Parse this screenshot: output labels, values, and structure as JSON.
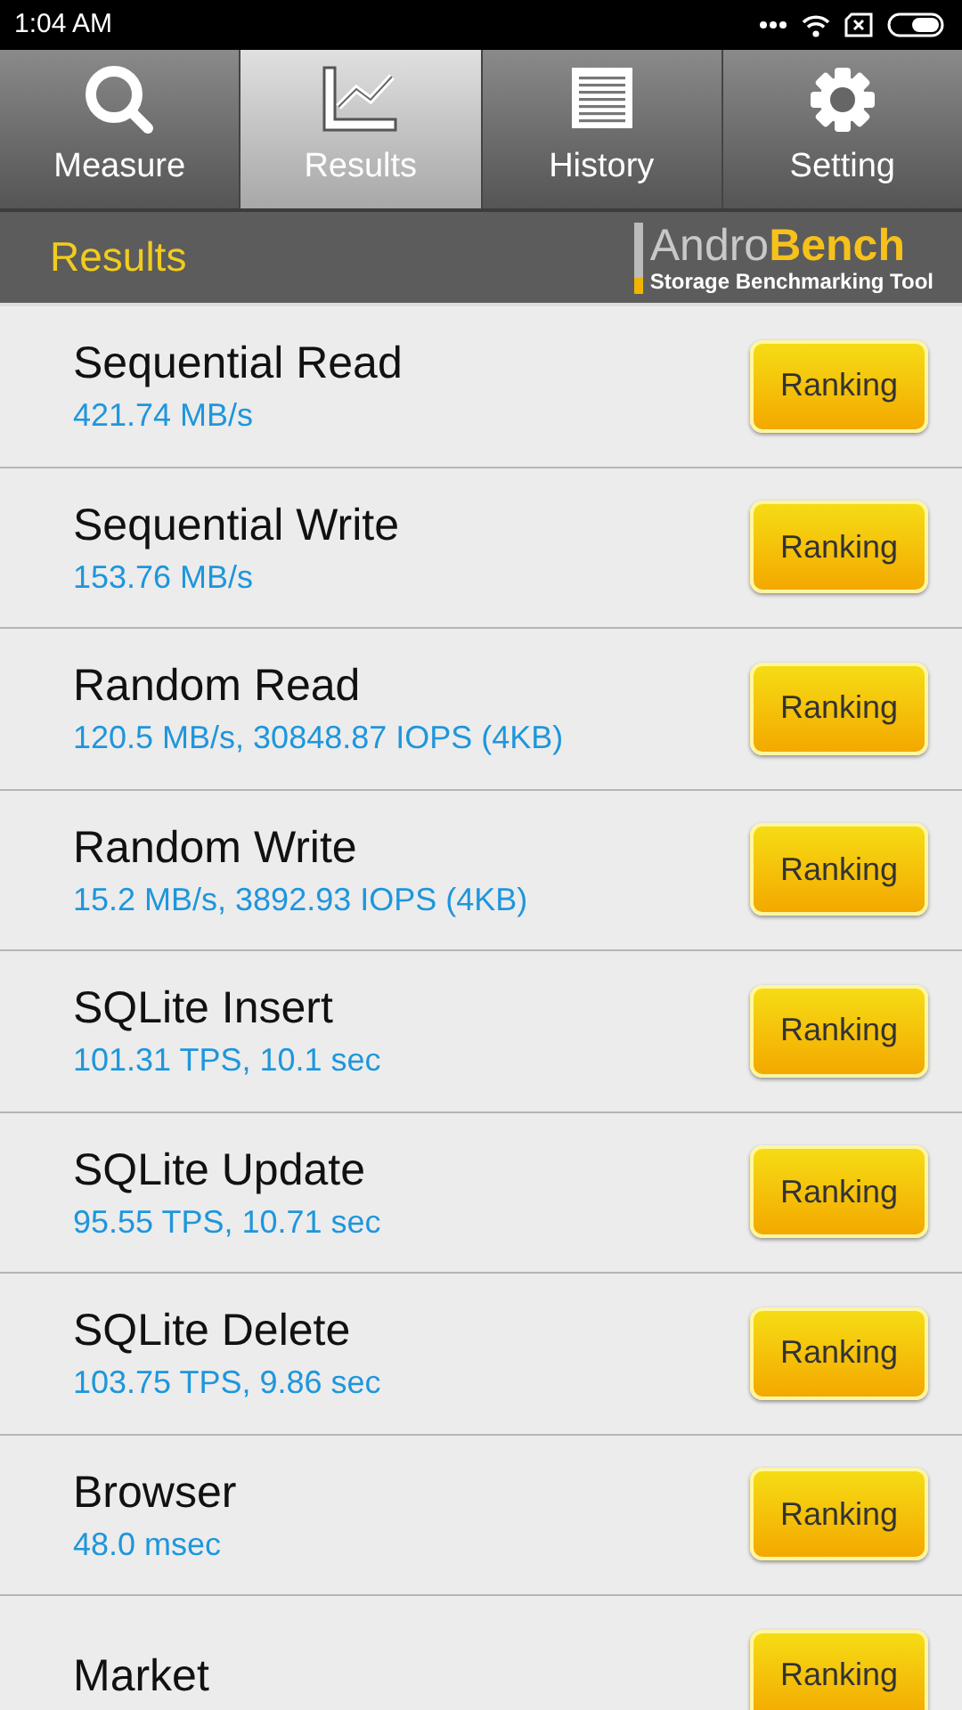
{
  "status_bar": {
    "time": "1:04 AM"
  },
  "tabs": [
    {
      "label": "Measure",
      "selected": false
    },
    {
      "label": "Results",
      "selected": true
    },
    {
      "label": "History",
      "selected": false
    },
    {
      "label": "Setting",
      "selected": false
    }
  ],
  "header": {
    "title": "Results",
    "brand_first": "Andro",
    "brand_second": "Bench",
    "tagline": "Storage Benchmarking Tool"
  },
  "results": [
    {
      "name": "Sequential Read",
      "value": "421.74 MB/s",
      "button": "Ranking"
    },
    {
      "name": "Sequential Write",
      "value": "153.76 MB/s",
      "button": "Ranking"
    },
    {
      "name": "Random Read",
      "value": "120.5 MB/s, 30848.87 IOPS (4KB)",
      "button": "Ranking"
    },
    {
      "name": "Random Write",
      "value": "15.2 MB/s, 3892.93 IOPS (4KB)",
      "button": "Ranking"
    },
    {
      "name": "SQLite Insert",
      "value": "101.31 TPS, 10.1 sec",
      "button": "Ranking"
    },
    {
      "name": "SQLite Update",
      "value": "95.55 TPS, 10.71 sec",
      "button": "Ranking"
    },
    {
      "name": "SQLite Delete",
      "value": "103.75 TPS, 9.86 sec",
      "button": "Ranking"
    },
    {
      "name": "Browser",
      "value": "48.0 msec",
      "button": "Ranking"
    },
    {
      "name": "Market",
      "button": "Ranking"
    }
  ]
}
